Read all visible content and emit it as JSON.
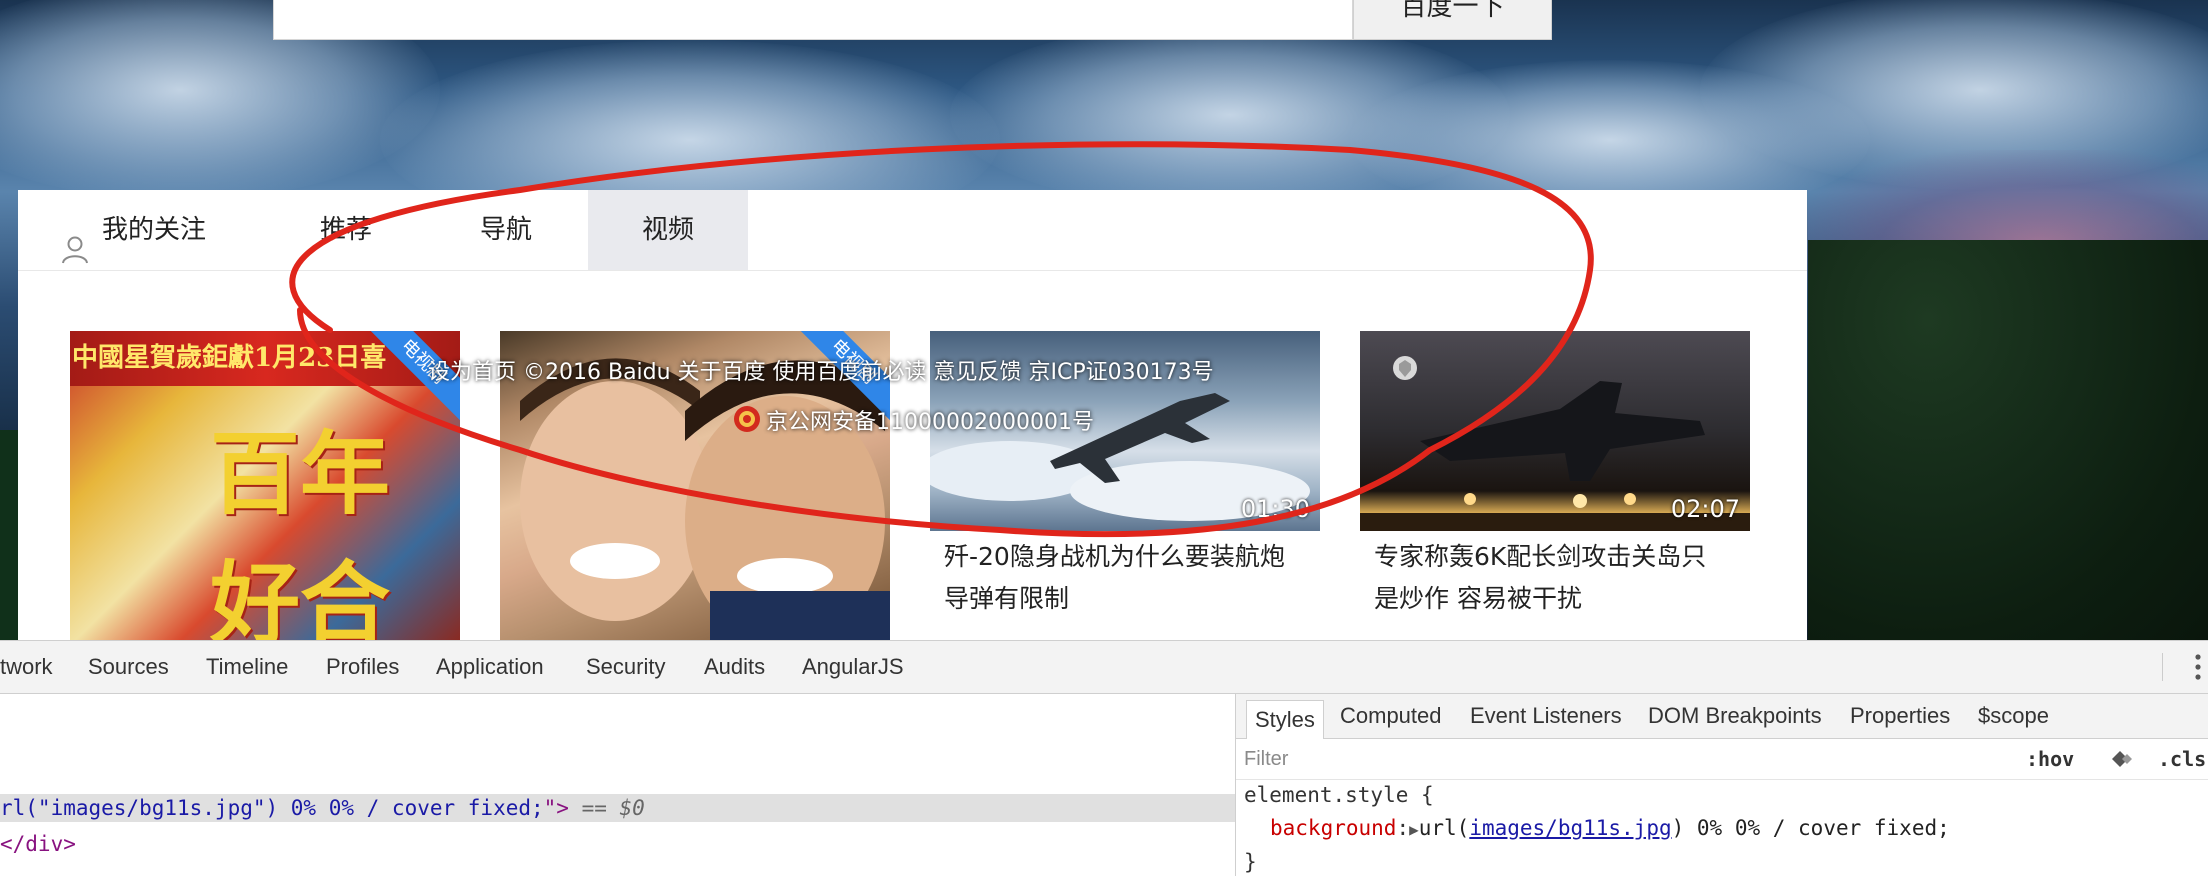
{
  "search": {
    "button_label": "百度一下",
    "input_value": ""
  },
  "tabs": [
    {
      "label": "我的关注",
      "icon": "user-icon",
      "active": false
    },
    {
      "label": "推荐",
      "active": false
    },
    {
      "label": "导航",
      "active": false
    },
    {
      "label": "视频",
      "active": true
    }
  ],
  "cards": [
    {
      "poster_text": "中國星賀歲鉅獻1月23日喜",
      "poster_title": "百年好合",
      "badge": "电视剧",
      "duration": "",
      "title_line1": "",
      "title_line2": ""
    },
    {
      "poster_text": "",
      "badge": "电视剧",
      "duration": "",
      "title_line1": "",
      "title_line2": ""
    },
    {
      "badge": "",
      "duration": "01:30",
      "title_line1": "歼-20隐身战机为什么要装航炮",
      "title_line2": "导弹有限制"
    },
    {
      "badge": "",
      "duration": "02:07",
      "title_line1": "专家称轰6K配长剑攻击关岛只",
      "title_line2": "是炒作 容易被干扰"
    }
  ],
  "footer_overlay": {
    "line1": "设为首页  ©2016 Baidu  关于百度   使用百度前必读    意见反馈   京ICP证030173号",
    "line2": "京公网安备11000002000001号"
  },
  "devtools": {
    "main_tabs": [
      "twork",
      "Sources",
      "Timeline",
      "Profiles",
      "Application",
      "Security",
      "Audits",
      "AngularJS"
    ],
    "elements": {
      "selected_line_prefix": "rl(\"images/bg11s.jpg\") 0% 0% / cover fixed;",
      "selected_line_quote": "\">",
      "selected_line_suffix": " == $0",
      "closing_tag": "</div>"
    },
    "styles": {
      "tabs": [
        "Styles",
        "Computed",
        "Event Listeners",
        "DOM Breakpoints",
        "Properties",
        "$scope"
      ],
      "active_tab": "Styles",
      "filter_placeholder": "Filter",
      "hov_label": ":hov",
      "cls_label": ".cls",
      "rule_selector": "element.style {",
      "property_name": "background",
      "property_value_prefix": "url(",
      "property_link": "images/bg11s.jpg",
      "property_value_suffix": ") 0% 0% / cover fixed;",
      "closing_brace": "}"
    }
  },
  "colors": {
    "annotation_red": "#e0251b",
    "badge_blue": "#2f86e8",
    "active_tab_bg": "#e9eaee",
    "css_property": "#c80000",
    "css_link": "#1a1aa6"
  }
}
